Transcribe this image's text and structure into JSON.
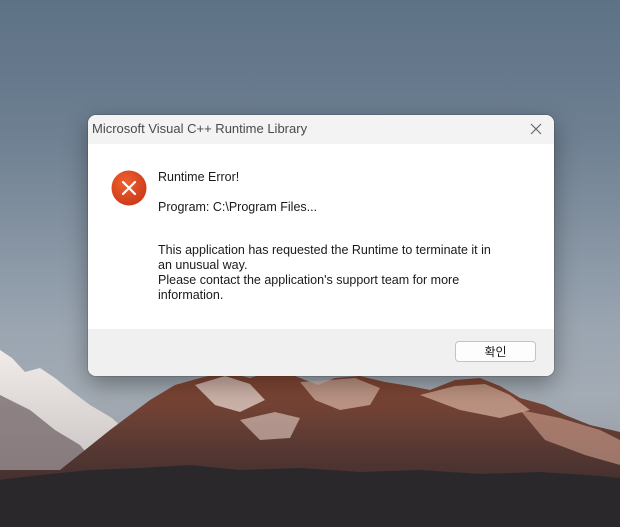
{
  "dialog": {
    "title": "Microsoft Visual C++ Runtime Library",
    "heading": "Runtime Error!",
    "program_line": "Program: C:\\Program Files...",
    "body_lines": [
      "This application has requested the Runtime to terminate it in",
      "an unusual way.",
      "Please contact the application's support team for more",
      "information."
    ],
    "ok_label": "확인",
    "icon": "error-x-icon",
    "close_icon": "close-icon"
  },
  "colors": {
    "error_icon": "#e2461c",
    "title_bar": "#f3f3f3",
    "footer": "#f0f0f0"
  }
}
